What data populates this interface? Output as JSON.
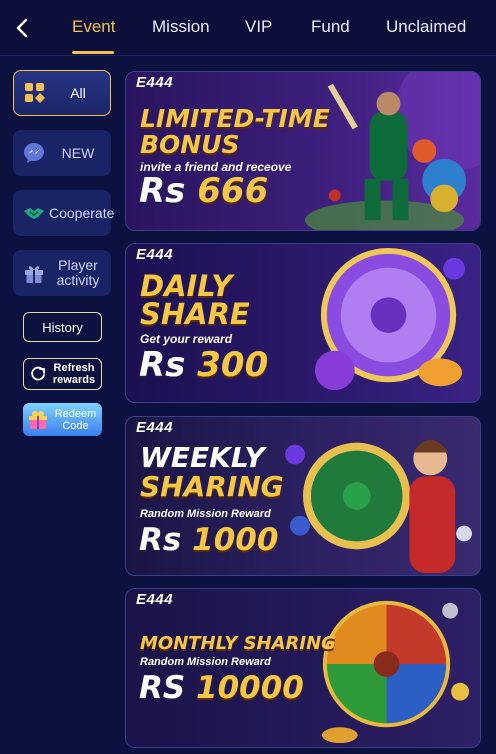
{
  "nav": {
    "tabs": [
      {
        "label": "Event",
        "active": true
      },
      {
        "label": "Mission",
        "active": false
      },
      {
        "label": "VIP",
        "active": false
      },
      {
        "label": "Fund",
        "active": false
      },
      {
        "label": "Unclaimed",
        "active": false
      }
    ],
    "back_icon": "chevron-left-icon"
  },
  "sidebar": {
    "items": [
      {
        "label": "All",
        "icon": "grid-icon",
        "active": true
      },
      {
        "label": "NEW",
        "icon": "messenger-icon",
        "active": false
      },
      {
        "label": "Cooperate",
        "icon": "handshake-icon",
        "active": false
      },
      {
        "label": "Player activity",
        "icon": "gift-icon",
        "active": false
      }
    ],
    "history_label": "History",
    "refresh_label": "Refresh rewards",
    "redeem_label": "Redeem Code"
  },
  "banners": [
    {
      "brand": "E444",
      "line1": "LIMITED-TIME",
      "line2": "BONUS",
      "subtitle": "invite a friend and receove",
      "currency": "Rs",
      "amount": "666"
    },
    {
      "brand": "E444",
      "line1": "DAILY",
      "line2": "SHARE",
      "subtitle": "Get your reward",
      "currency": "Rs",
      "amount": "300"
    },
    {
      "brand": "E444",
      "line1": "WEEKLY",
      "line2": "SHARING",
      "subtitle": "Random Mission Reward",
      "currency": "Rs",
      "amount": "1000"
    },
    {
      "brand": "E444",
      "line1": "MONTHLY SHARING",
      "line2": "",
      "subtitle": "Random Mission Reward",
      "currency": "RS",
      "amount": "10000"
    }
  ],
  "colors": {
    "background": "#0d1140",
    "accent": "#f2c14e",
    "gold_text": "#f6c744"
  }
}
